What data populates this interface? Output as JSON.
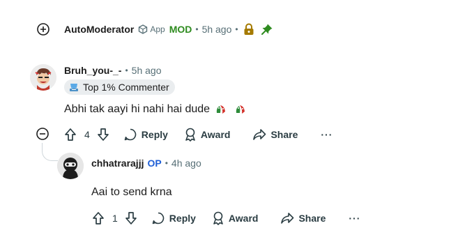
{
  "automod": {
    "username": "AutoModerator",
    "app_label": "App",
    "mod_label": "MOD",
    "separator": "•",
    "time": "5h ago"
  },
  "comment1": {
    "username": "Bruh_you-_-",
    "separator": "•",
    "time": "5h ago",
    "flair": "Top 1% Commenter",
    "body": "Abhi tak aayi hi nahi hai dude",
    "votes": "4",
    "reply_label": "Reply",
    "award_label": "Award",
    "share_label": "Share",
    "more_label": "···"
  },
  "comment2": {
    "username": "chhatrarajjj",
    "op_label": "OP",
    "separator": "•",
    "time": "4h ago",
    "body": "Aai to send krna",
    "votes": "1",
    "reply_label": "Reply",
    "award_label": "Award",
    "share_label": "Share",
    "more_label": "···"
  },
  "colors": {
    "mod_green": "#2e8b1f",
    "op_blue": "#1f5fd6",
    "meta_gray": "#576f76",
    "lock_gold": "#a57a00"
  },
  "icons": [
    "expand-plus-icon",
    "collapse-minus-icon",
    "app-badge-icon",
    "lock-icon",
    "pin-icon",
    "trophy-icon",
    "emoji-icon",
    "upvote-icon",
    "downvote-icon",
    "reply-icon",
    "award-icon",
    "share-icon",
    "more-icon"
  ]
}
